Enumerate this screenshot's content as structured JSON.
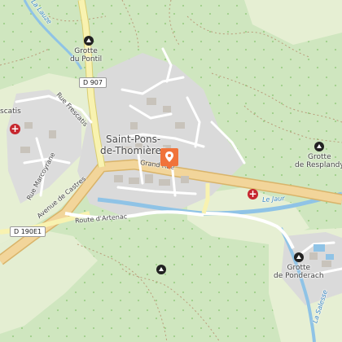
{
  "map": {
    "colors": {
      "forest": "#cfe6bf",
      "meadow": "#e6efd3",
      "urban": "#dadada",
      "water": "#8fc3e6",
      "major_road": "#f2d59a",
      "secondary_road": "#f8f2b0",
      "marker": "#f0733a",
      "pharmacy": "#c6262e"
    },
    "town": {
      "line1": "Saint-Pons-",
      "line2": "de-Thomières"
    },
    "roads": {
      "d907": "D 907",
      "d190e1": "D 190E1",
      "grand_rue": "Grand Rue",
      "avenue_castres": "Avenue de Castres",
      "route_artenac": "Route d'Artenac",
      "rue_frescatis": "Rue Frescatis",
      "rue_marcoyrane": "Rue Marcoyrane"
    },
    "water": {
      "jaur": "Le Jaur",
      "lauze": "La Lauze",
      "salesse": "La Salesse"
    },
    "pois": {
      "pontil_line1": "Grotte",
      "pontil_line2": "du Pontil",
      "resplandy_line1": "Grotte",
      "resplandy_line2": "de Resplandy",
      "ponderach_line1": "Grotte",
      "ponderach_line2": "de Ponderach",
      "frescatis": "scatis"
    },
    "icons": [
      "cave-icon",
      "pharmacy-icon",
      "location-marker-icon"
    ]
  }
}
